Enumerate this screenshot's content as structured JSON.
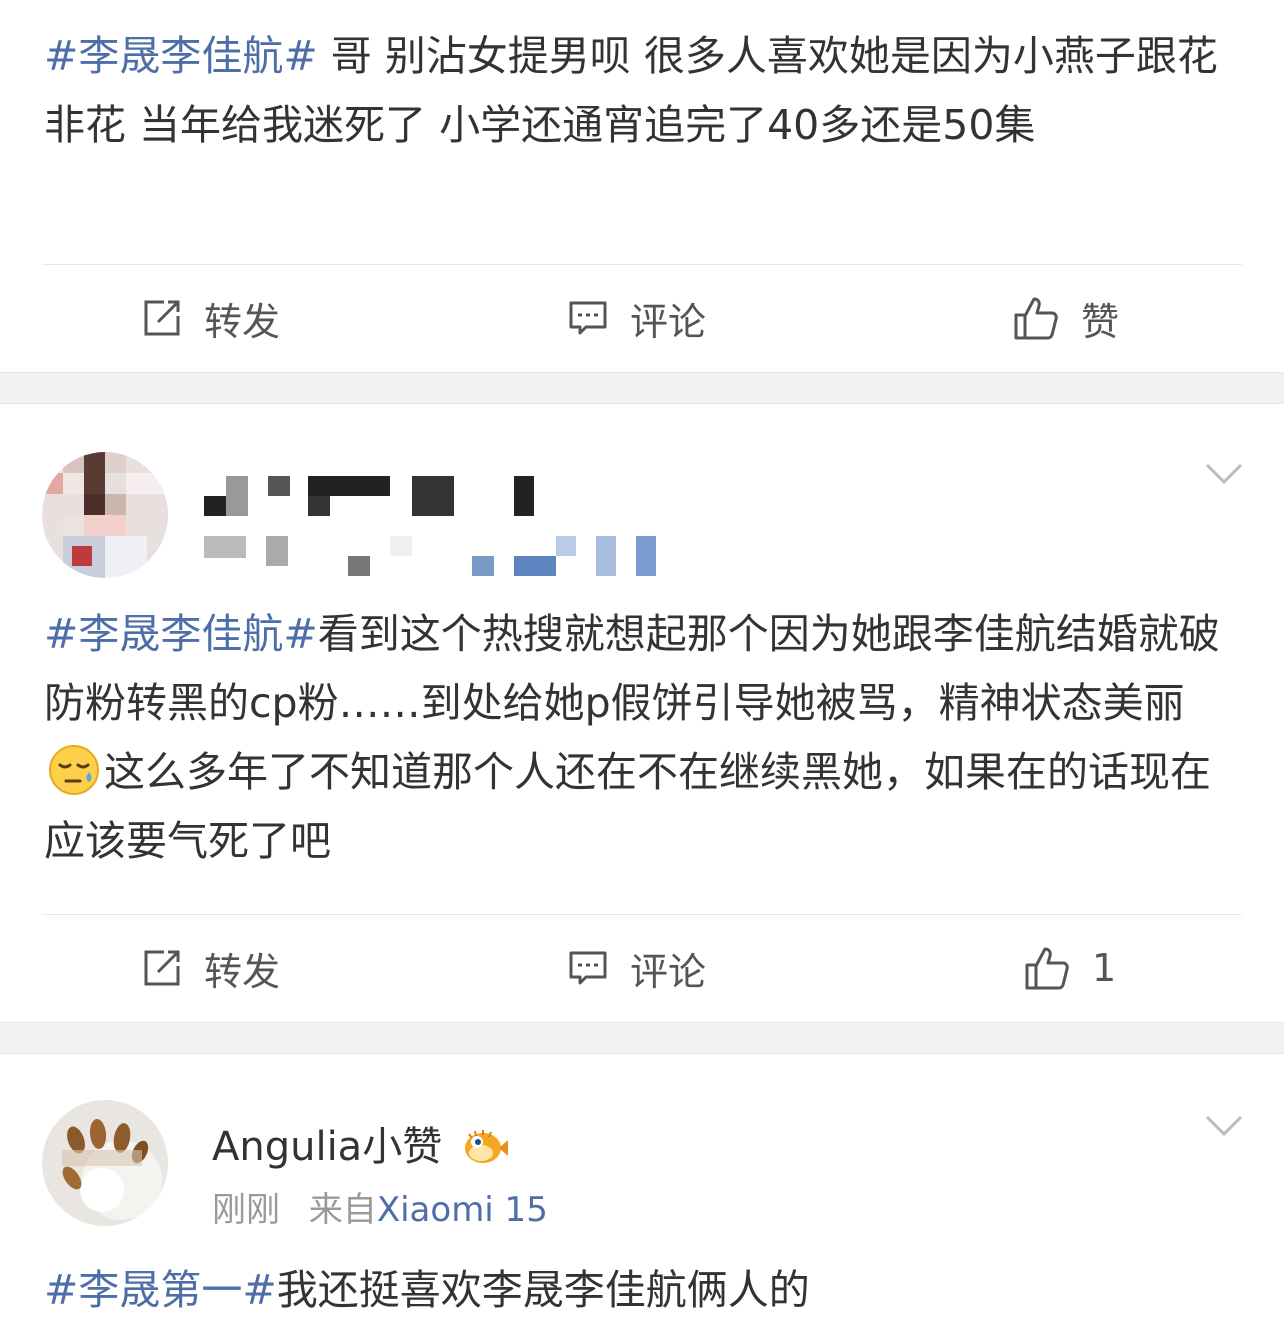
{
  "posts": [
    {
      "tag": "#李晟李佳航#",
      "text": " 哥 别沾女提男呗 很多人喜欢她是因为小燕子跟花非花 当年给我迷死了 小学还通宵追完了40多还是50集",
      "actions": {
        "repost": "转发",
        "comment": "评论",
        "like": "赞"
      }
    },
    {
      "tag": "#李晟李佳航#",
      "text_before_emoji": "看到这个热搜就想起那个因为她跟李佳航结婚就破防粉转黑的cp粉……到处给她p假饼引导她被骂，精神状态美丽",
      "text_after_emoji": "这么多年了不知道那个人还在不在继续黑她，如果在的话现在应该要气死了吧",
      "emoji": "sweat-emoji",
      "actions": {
        "repost": "转发",
        "comment": "评论",
        "like": "1"
      }
    },
    {
      "username": "Angulia小赞",
      "badge": "pufferfish-badge-icon",
      "time": "刚刚",
      "source_prefix": "来自",
      "source": "Xiaomi 15",
      "tag": "#李晟第一#",
      "text": "我还挺喜欢李晟李佳航俩人的"
    }
  ],
  "colors": {
    "link": "#4e6ea8",
    "text": "#333333",
    "muted": "#999999",
    "gap": "#f2f2f2"
  }
}
